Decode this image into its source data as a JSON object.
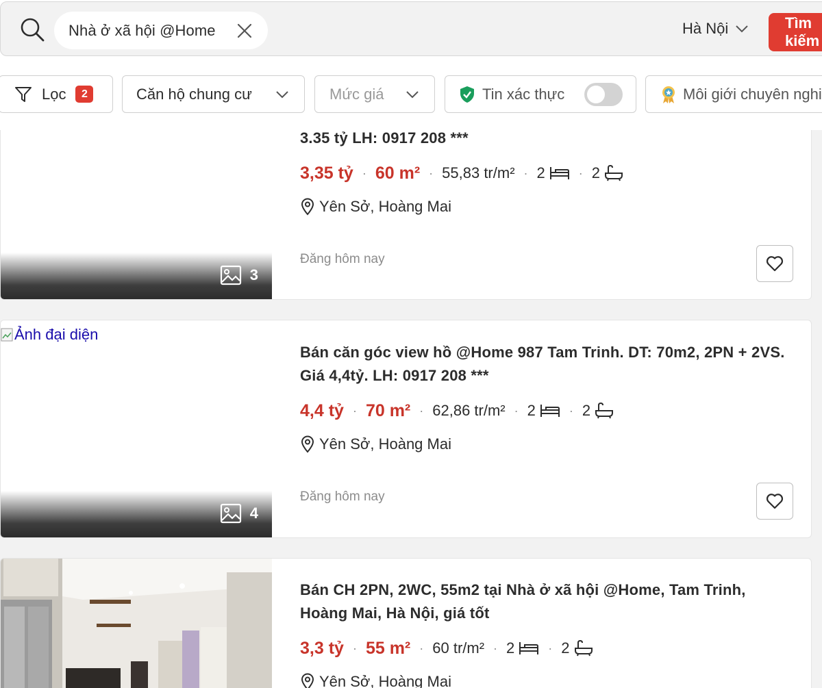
{
  "search": {
    "query": "Nhà ở xã hội @Home",
    "city": "Hà Nội",
    "button_label": "Tìm kiếm"
  },
  "filters": {
    "filter_label": "Lọc",
    "filter_count": "2",
    "property_type": "Căn hộ chung cư",
    "price": "Mức giá",
    "verified": "Tin xác thực",
    "broker": "Môi giới chuyên nghiệp"
  },
  "colors": {
    "accent": "#e03c31",
    "price": "#c8342a",
    "verified_shield": "#1a9e5c"
  },
  "listings": [
    {
      "title_tail": "3.35 tỷ LH: 0917 208 ***",
      "price": "3,35 tỷ",
      "area": "60 m²",
      "price_per_m2": "55,83 tr/m²",
      "bedrooms": "2",
      "bathrooms": "2",
      "location": "Yên Sở, Hoàng Mai",
      "posted": "Đăng hôm nay",
      "photo_count": "3"
    },
    {
      "image_alt": "Ảnh đại diện",
      "title": "Bán căn góc view hồ @Home 987 Tam Trinh. DT: 70m2, 2PN + 2VS. Giá 4,4tỷ. LH: 0917 208 ***",
      "price": "4,4 tỷ",
      "area": "70 m²",
      "price_per_m2": "62,86 tr/m²",
      "bedrooms": "2",
      "bathrooms": "2",
      "location": "Yên Sở, Hoàng Mai",
      "posted": "Đăng hôm nay",
      "photo_count": "4"
    },
    {
      "title": "Bán CH 2PN, 2WC, 55m2 tại Nhà ở xã hội @Home, Tam Trinh, Hoàng Mai, Hà Nội, giá tốt",
      "price": "3,3 tỷ",
      "area": "55 m²",
      "price_per_m2": "60 tr/m²",
      "bedrooms": "2",
      "bathrooms": "2",
      "location": "Yên Sở, Hoàng Mai"
    }
  ]
}
